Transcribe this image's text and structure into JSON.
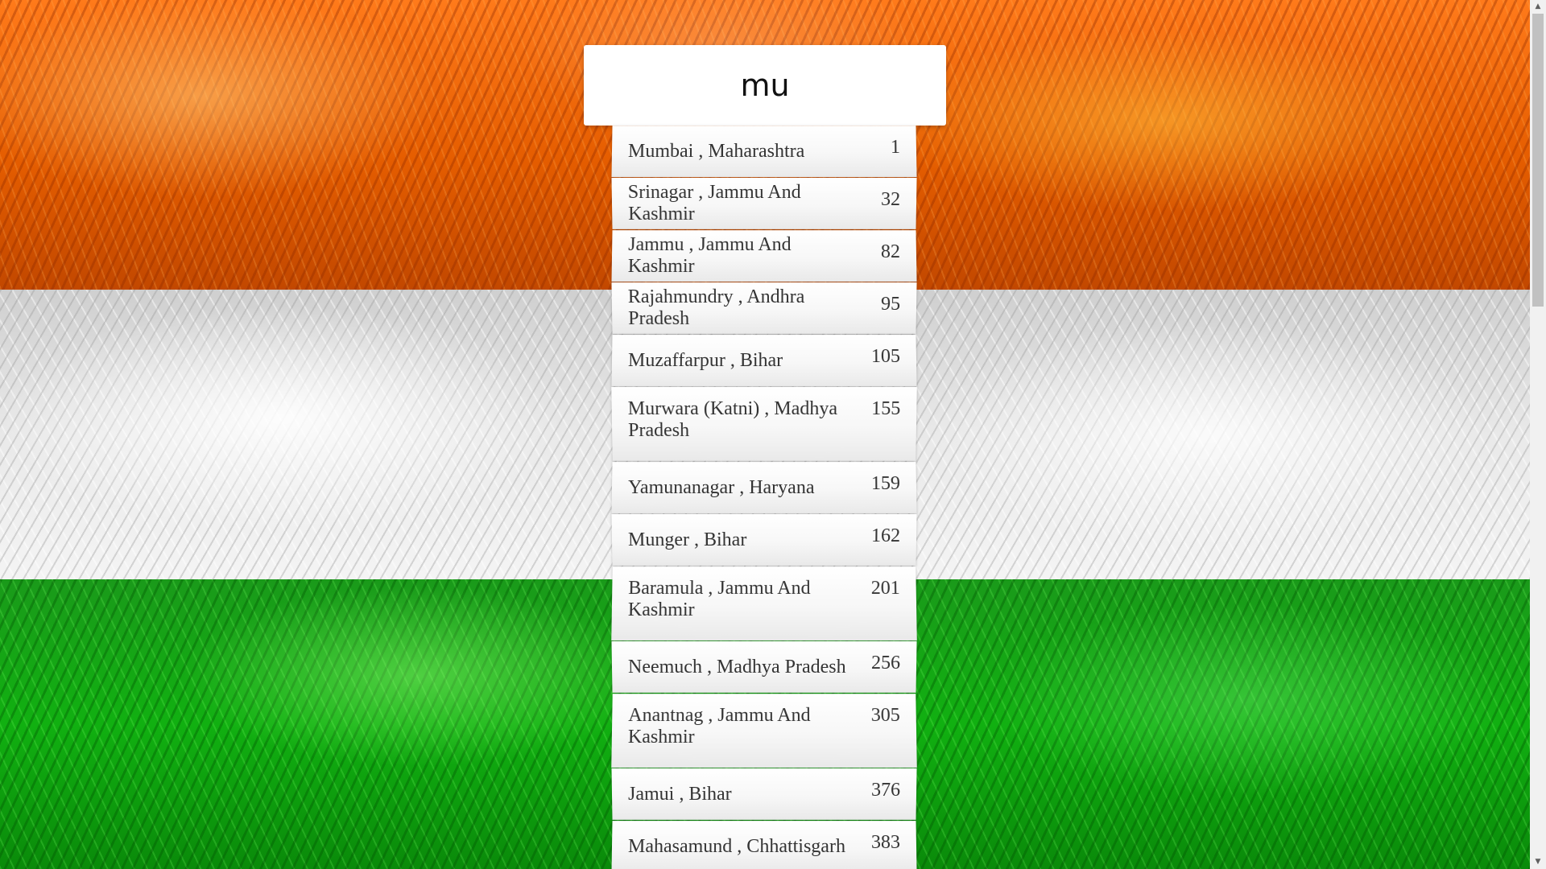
{
  "search": {
    "value": "mu"
  },
  "suggestions": [
    {
      "name": "Mumbai , Maharashtra",
      "rank": "1"
    },
    {
      "name": "Srinagar , Jammu And Kashmir",
      "rank": "32"
    },
    {
      "name": "Jammu , Jammu And Kashmir",
      "rank": "82"
    },
    {
      "name": "Rajahmundry , Andhra Pradesh",
      "rank": "95"
    },
    {
      "name": "Muzaffarpur , Bihar",
      "rank": "105"
    },
    {
      "name": "Murwara (Katni) , Madhya Pradesh",
      "rank": "155"
    },
    {
      "name": "Yamunanagar , Haryana",
      "rank": "159"
    },
    {
      "name": "Munger , Bihar",
      "rank": "162"
    },
    {
      "name": "Baramula , Jammu And Kashmir",
      "rank": "201"
    },
    {
      "name": "Neemuch , Madhya Pradesh",
      "rank": "256"
    },
    {
      "name": "Anantnag , Jammu And Kashmir",
      "rank": "305"
    },
    {
      "name": "Jamui , Bihar",
      "rank": "376"
    },
    {
      "name": "Mahasamund , Chhattisgarh",
      "rank": "383"
    }
  ],
  "colors": {
    "saffron": "#e55d00",
    "white": "#e9e9e9",
    "green": "#11b011"
  },
  "icons": {
    "scroll_up": "scroll-up-arrow-icon",
    "scroll_down": "scroll-down-arrow-icon"
  }
}
